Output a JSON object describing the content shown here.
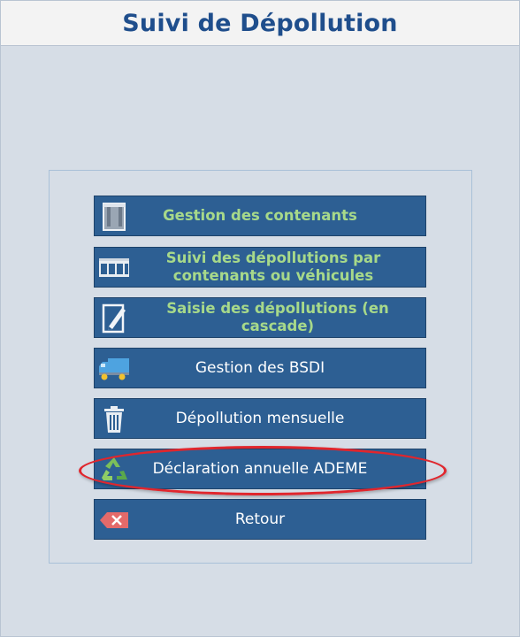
{
  "header": {
    "title": "Suivi de Dépollution"
  },
  "menu": {
    "items": [
      {
        "label": "Gestion des contenants",
        "icon": "container-icon"
      },
      {
        "label_line1": "Suivi des dépollutions par",
        "label_line2": "contenants ou véhicules",
        "icon": "storage-rack-icon"
      },
      {
        "label": "Saisie des dépollutions (en cascade)",
        "icon": "edit-form-icon"
      },
      {
        "label": "Gestion des BSDI",
        "icon": "truck-icon"
      },
      {
        "label": "Dépollution mensuelle",
        "icon": "trash-bin-icon"
      },
      {
        "label": "Déclaration annuelle ADEME",
        "icon": "recycle-icon"
      },
      {
        "label": "Retour",
        "icon": "backspace-close-icon"
      }
    ]
  },
  "colors": {
    "button_bg": "#2d5f93",
    "green_label": "#a7d98a",
    "title": "#1f4e8c",
    "highlight": "#e0262d"
  }
}
